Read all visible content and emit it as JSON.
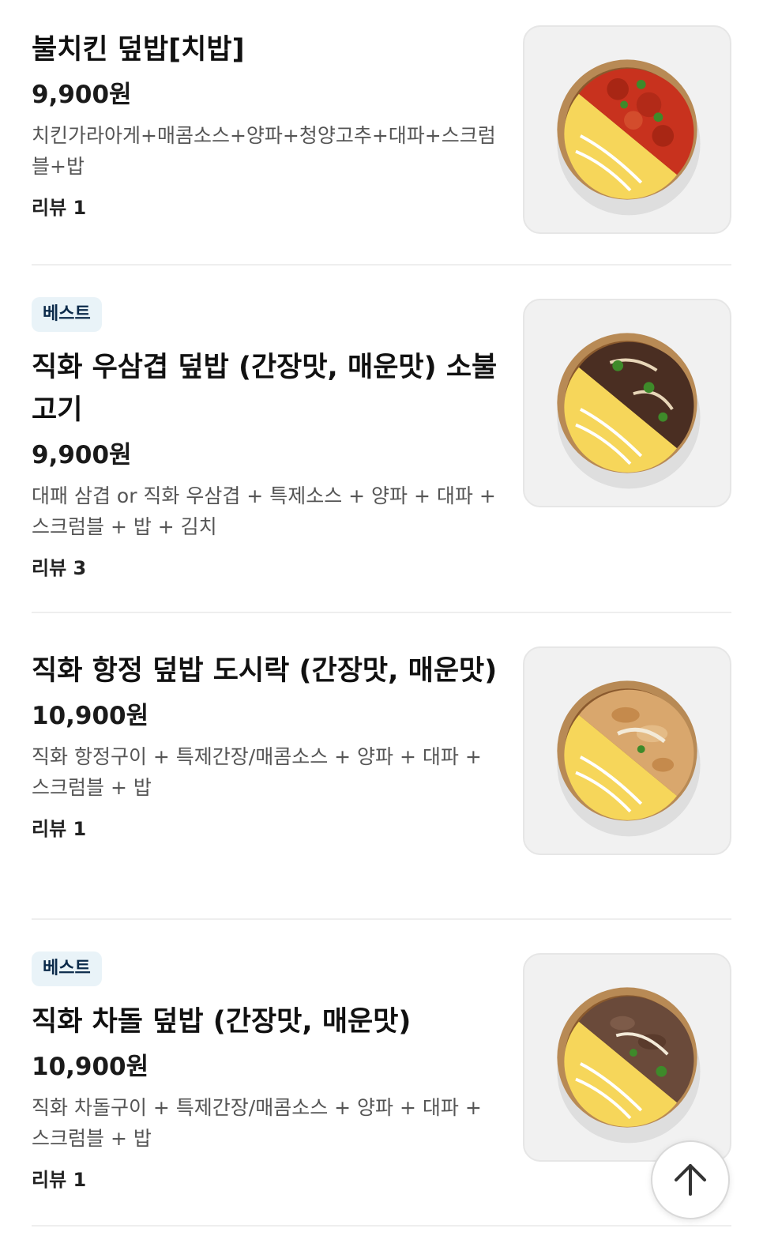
{
  "menu": {
    "items": [
      {
        "badge": "",
        "name": "불치킨 덮밥[치밥]",
        "price": "9,900원",
        "description": "치킨가라아게+매콤소스+양파+청양고추+대파+스크럼블+밥",
        "review": "리뷰 1",
        "image_icon": "spicy-chicken-rice-bowl"
      },
      {
        "badge": "베스트",
        "name": "직화 우삼겹 덮밥 (간장맛, 매운맛) 소불고기",
        "price": "9,900원",
        "description": "대패 삼겹 or 직화 우삼겹 + 특제소스 + 양파 + 대파 + 스크럼블 + 밥 + 김치",
        "review": "리뷰 3",
        "image_icon": "beef-rice-bowl"
      },
      {
        "badge": "",
        "name": "직화 항정 덮밥 도시락 (간장맛, 매운맛)",
        "price": "10,900원",
        "description": "직화 항정구이 + 특제간장/매콤소스 + 양파 + 대파 + 스크럼블 + 밥",
        "review": "리뷰 1",
        "image_icon": "pork-jowl-rice-bowl"
      },
      {
        "badge": "베스트",
        "name": "직화 차돌 덮밥 (간장맛, 매운맛)",
        "price": "10,900원",
        "description": "직화 차돌구이 + 특제간장/매콤소스 + 양파 + 대파 + 스크럼블 + 밥",
        "review": "리뷰 1",
        "image_icon": "brisket-rice-bowl"
      }
    ]
  },
  "scroll_top": {
    "icon": "arrow-up-icon"
  },
  "colors": {
    "badge_bg": "#e9f3f8",
    "badge_text": "#0b2a4a",
    "divider": "#eeeeee",
    "bowl_rim": "#b88a55",
    "egg": "#f6d65a",
    "spicy_sauce": "#c8321e",
    "beef": "#4a2e22",
    "pork": "#d9a76d",
    "pepper": "#3e8a2a"
  }
}
